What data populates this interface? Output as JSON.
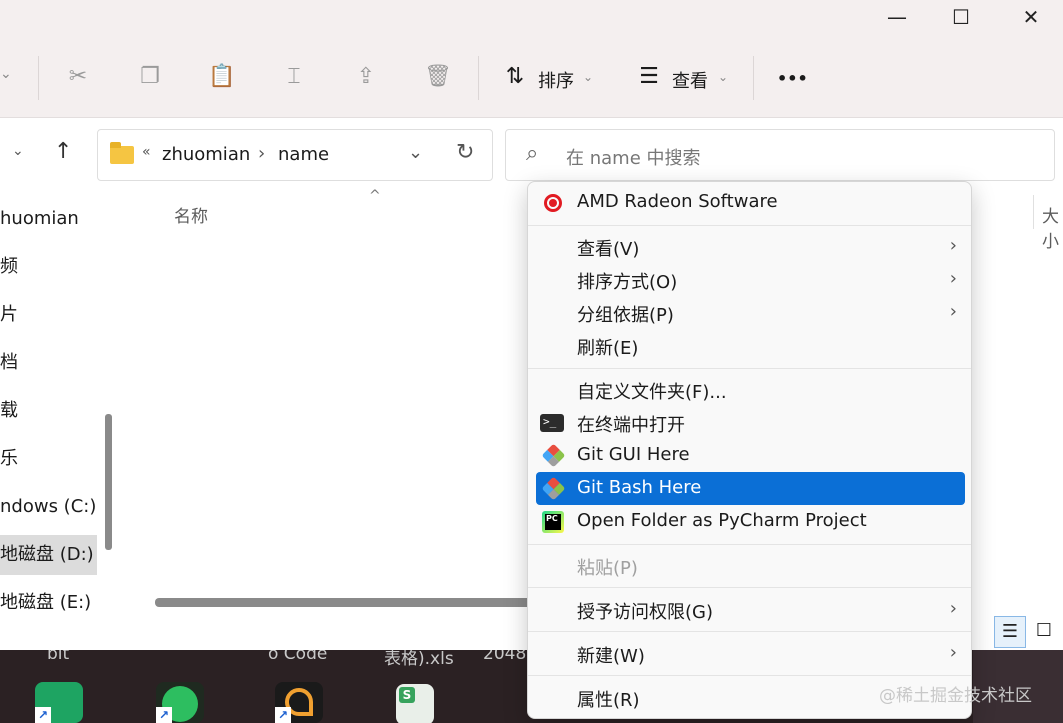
{
  "window": {
    "caption_minimize": "—",
    "caption_maximize": "☐",
    "caption_close": "✕"
  },
  "toolbar": {
    "dropdown_chevron": "⌄",
    "sort_label": "排序",
    "view_label": "查看",
    "more_label": "•••"
  },
  "navigation": {
    "back_chevron": "⌄",
    "up_arrow": "↑",
    "breadcrumb_overflow": "«",
    "breadcrumb": [
      "zhuomian",
      "name"
    ],
    "breadcrumb_separator": "›",
    "dropdown": "⌄",
    "refresh": "↻"
  },
  "search": {
    "icon": "⌕",
    "placeholder": "在 name 中搜索"
  },
  "sidebar": {
    "items": [
      {
        "label": "huomian",
        "selected": false
      },
      {
        "label": "频",
        "selected": false
      },
      {
        "label": "片",
        "selected": false
      },
      {
        "label": "档",
        "selected": false
      },
      {
        "label": "载",
        "selected": false
      },
      {
        "label": "乐",
        "selected": false
      },
      {
        "label": "ndows (C:)",
        "selected": false
      },
      {
        "label": "地磁盘 (D:)",
        "selected": true
      },
      {
        "label": "地磁盘 (E:)",
        "selected": false
      }
    ]
  },
  "content": {
    "column_name": "名称",
    "sort_indicator": "^",
    "column_size": "大小"
  },
  "statusbar": {
    "details_view_icon": "☰",
    "tiles_view_icon": "☐"
  },
  "desktop": {
    "labels": [
      "bit",
      "o Code",
      "表格).xls",
      "2048"
    ]
  },
  "context_menu": {
    "amd": "AMD Radeon Software",
    "view": "查看(V)",
    "sort_by": "排序方式(O)",
    "group_by": "分组依据(P)",
    "refresh": "刷新(E)",
    "customize_folder": "自定义文件夹(F)...",
    "open_terminal": "在终端中打开",
    "git_gui": "Git GUI Here",
    "git_bash": "Git Bash Here",
    "pycharm": "Open Folder as PyCharm Project",
    "paste": "粘贴(P)",
    "give_access": "授予访问权限(G)",
    "new": "新建(W)",
    "properties": "属性(R)",
    "submenu_arrow": "›"
  },
  "watermark": "@稀土掘金技术社区",
  "colors": {
    "highlight": "#0b6fd6",
    "amd_red": "#e11b22",
    "folder_yellow": "#f5c542"
  }
}
